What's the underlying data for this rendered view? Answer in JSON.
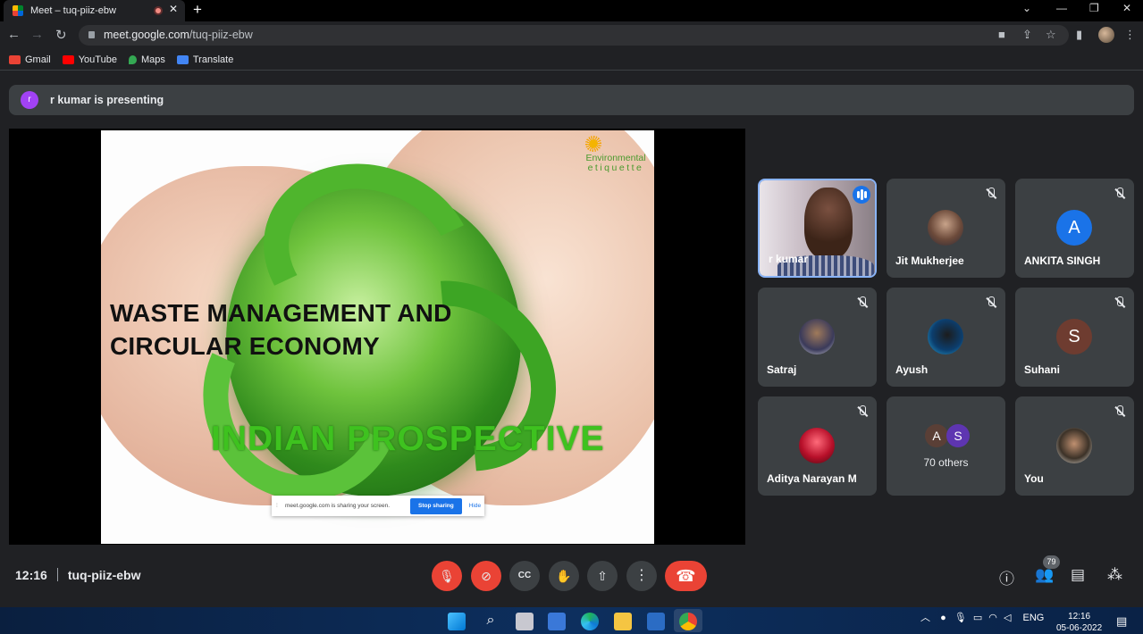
{
  "browser": {
    "tab_title": "Meet – tuq-piiz-ebw",
    "tab_close": "✕",
    "new_tab": "+",
    "url_host": "meet.google.com",
    "url_path": "/tuq-piiz-ebw",
    "bookmarks": [
      {
        "label": "Gmail",
        "icon": "gmail-icon",
        "color": "#ea4335"
      },
      {
        "label": "YouTube",
        "icon": "youtube-icon",
        "color": "#ff0000"
      },
      {
        "label": "Maps",
        "icon": "maps-icon",
        "color": "#34a853"
      },
      {
        "label": "Translate",
        "icon": "translate-icon",
        "color": "#4285f4"
      }
    ]
  },
  "presenting_banner": {
    "avatar_letter": "r",
    "text": "r kumar is presenting"
  },
  "slide": {
    "title_line1": "WASTE MANAGEMENT AND",
    "title_line2": "CIRCULAR ECONOMY",
    "subtitle": "INDIAN  PROSPECTIVE",
    "logo_line1": "Environmental",
    "logo_line2": "etiquette"
  },
  "share_bar": {
    "message": "meet.google.com is sharing your screen.",
    "stop_label": "Stop sharing",
    "hide_label": "Hide"
  },
  "participants": [
    {
      "name": "r kumar",
      "type": "video",
      "speaking": true
    },
    {
      "name": "Jit Mukherjee",
      "type": "photo",
      "muted": true
    },
    {
      "name": "ANKITA SINGH",
      "type": "letter",
      "letter": "A",
      "color": "#1a73e8",
      "muted": true
    },
    {
      "name": "Satraj",
      "type": "photo",
      "muted": true
    },
    {
      "name": "Ayush",
      "type": "photo",
      "muted": true
    },
    {
      "name": "Suhani",
      "type": "letter",
      "letter": "S",
      "color": "#6e3c30",
      "muted": true
    },
    {
      "name": "Aditya Narayan M",
      "type": "photo",
      "muted": true
    },
    {
      "name": "70 others",
      "type": "group",
      "letters": [
        "A",
        "S"
      ]
    },
    {
      "name": "You",
      "type": "photo",
      "muted": true
    }
  ],
  "meeting": {
    "time": "12:16",
    "code": "tuq-piiz-ebw",
    "participant_count": "79"
  },
  "taskbar": {
    "language": "ENG",
    "time": "12:16",
    "date": "05-06-2022"
  }
}
